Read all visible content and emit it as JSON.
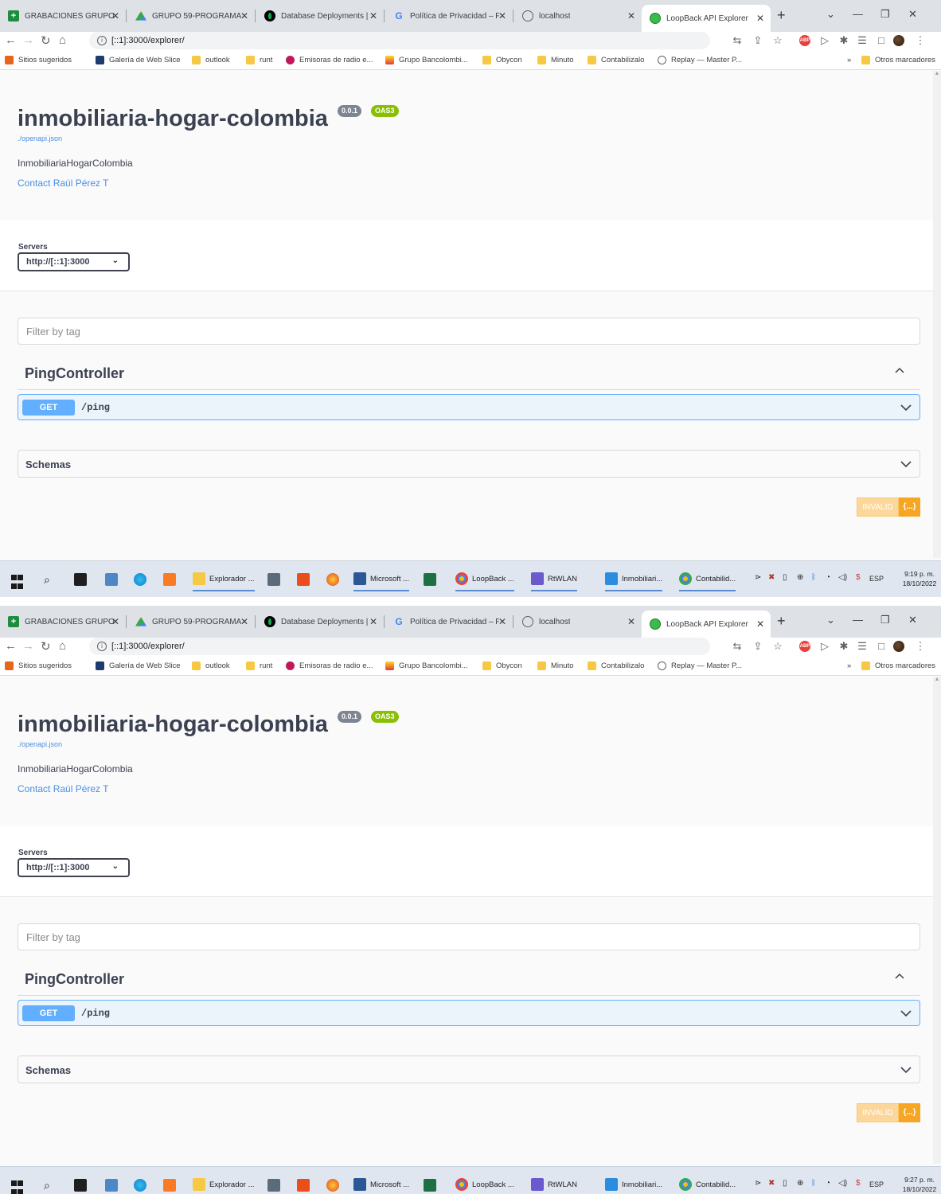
{
  "colors": {
    "get_method": "#61affe",
    "op_background": "#ebf3fb",
    "link": "#4990e2",
    "badge_version": "#7d8492",
    "badge_oas": "#89bf04",
    "invalid_text_bg": "#fcd79b",
    "invalid_icon_bg": "#f6a623",
    "taskbar": "#dfe6ef"
  },
  "screens": [
    {
      "browser": {
        "tabs": [
          {
            "title": "GRABACIONES GRUPO 5",
            "icon": "green-doc-icon"
          },
          {
            "title": "GRUPO 59-PROGRAMAC",
            "icon": "google-drive-icon"
          },
          {
            "title": "Database Deployments |",
            "icon": "mongodb-icon"
          },
          {
            "title": "Política de Privacidad – F",
            "icon": "google-icon"
          },
          {
            "title": "localhost",
            "icon": "globe-icon"
          },
          {
            "title": "LoopBack API Explorer",
            "icon": "loopback-icon",
            "active": true
          }
        ],
        "new_tab": "+",
        "url": "[::1]:3000/explorer/",
        "bookmarks": [
          "Sitios sugeridos",
          "Galería de Web Slice",
          "outlook",
          "runt",
          "Emisoras de radio e...",
          "Grupo Bancolombi...",
          "Obycon",
          "Minuto",
          "Contabilizalo",
          "Replay — Master P..."
        ],
        "bookmarks_more": "»",
        "other_bookmarks": "Otros marcadores"
      },
      "swagger": {
        "title": "inmobiliaria-hogar-colombia",
        "version": "0.0.1",
        "oas": "OAS3",
        "spec_link": "./openapi.json",
        "description": "InmobiliariaHogarColombia",
        "contact": "Contact Raúl Pérez T",
        "servers_label": "Servers",
        "server": "http://[::1]:3000",
        "filter_placeholder": "Filter by tag",
        "tag": "PingController",
        "operation": {
          "method": "GET",
          "path": "/ping"
        },
        "schemas": "Schemas",
        "validator": {
          "text": "INVALID",
          "icon": "{...}"
        }
      },
      "taskbar": {
        "apps": [
          "Explorador ...",
          "Microsoft ...",
          "LoopBack ...",
          "RtWLAN",
          "Inmobiliari...",
          "Contabilid..."
        ],
        "lang": "ESP",
        "time": "9:19 p. m.",
        "date": "18/10/2022"
      }
    },
    {
      "browser": {
        "tabs": [
          {
            "title": "GRABACIONES GRUPO 5",
            "icon": "green-doc-icon"
          },
          {
            "title": "GRUPO 59-PROGRAMAC",
            "icon": "google-drive-icon"
          },
          {
            "title": "Database Deployments |",
            "icon": "mongodb-icon"
          },
          {
            "title": "Política de Privacidad – F",
            "icon": "google-icon"
          },
          {
            "title": "localhost",
            "icon": "globe-icon"
          },
          {
            "title": "LoopBack API Explorer",
            "icon": "loopback-icon",
            "active": true
          }
        ],
        "new_tab": "+",
        "url": "[::1]:3000/explorer/",
        "bookmarks": [
          "Sitios sugeridos",
          "Galería de Web Slice",
          "outlook",
          "runt",
          "Emisoras de radio e...",
          "Grupo Bancolombi...",
          "Obycon",
          "Minuto",
          "Contabilizalo",
          "Replay — Master P..."
        ],
        "bookmarks_more": "»",
        "other_bookmarks": "Otros marcadores"
      },
      "swagger": {
        "title": "inmobiliaria-hogar-colombia",
        "version": "0.0.1",
        "oas": "OAS3",
        "spec_link": "./openapi.json",
        "description": "InmobiliariaHogarColombia",
        "contact": "Contact Raúl Pérez T",
        "servers_label": "Servers",
        "server": "http://[::1]:3000",
        "filter_placeholder": "Filter by tag",
        "tag": "PingController",
        "operation": {
          "method": "GET",
          "path": "/ping"
        },
        "schemas": "Schemas",
        "validator": {
          "text": "INVALID",
          "icon": "{...}"
        }
      },
      "taskbar": {
        "apps": [
          "Explorador ...",
          "Microsoft ...",
          "LoopBack ...",
          "RtWLAN",
          "Inmobiliari...",
          "Contabilid..."
        ],
        "lang": "ESP",
        "time": "9:27 p. m.",
        "date": "18/10/2022"
      }
    }
  ]
}
